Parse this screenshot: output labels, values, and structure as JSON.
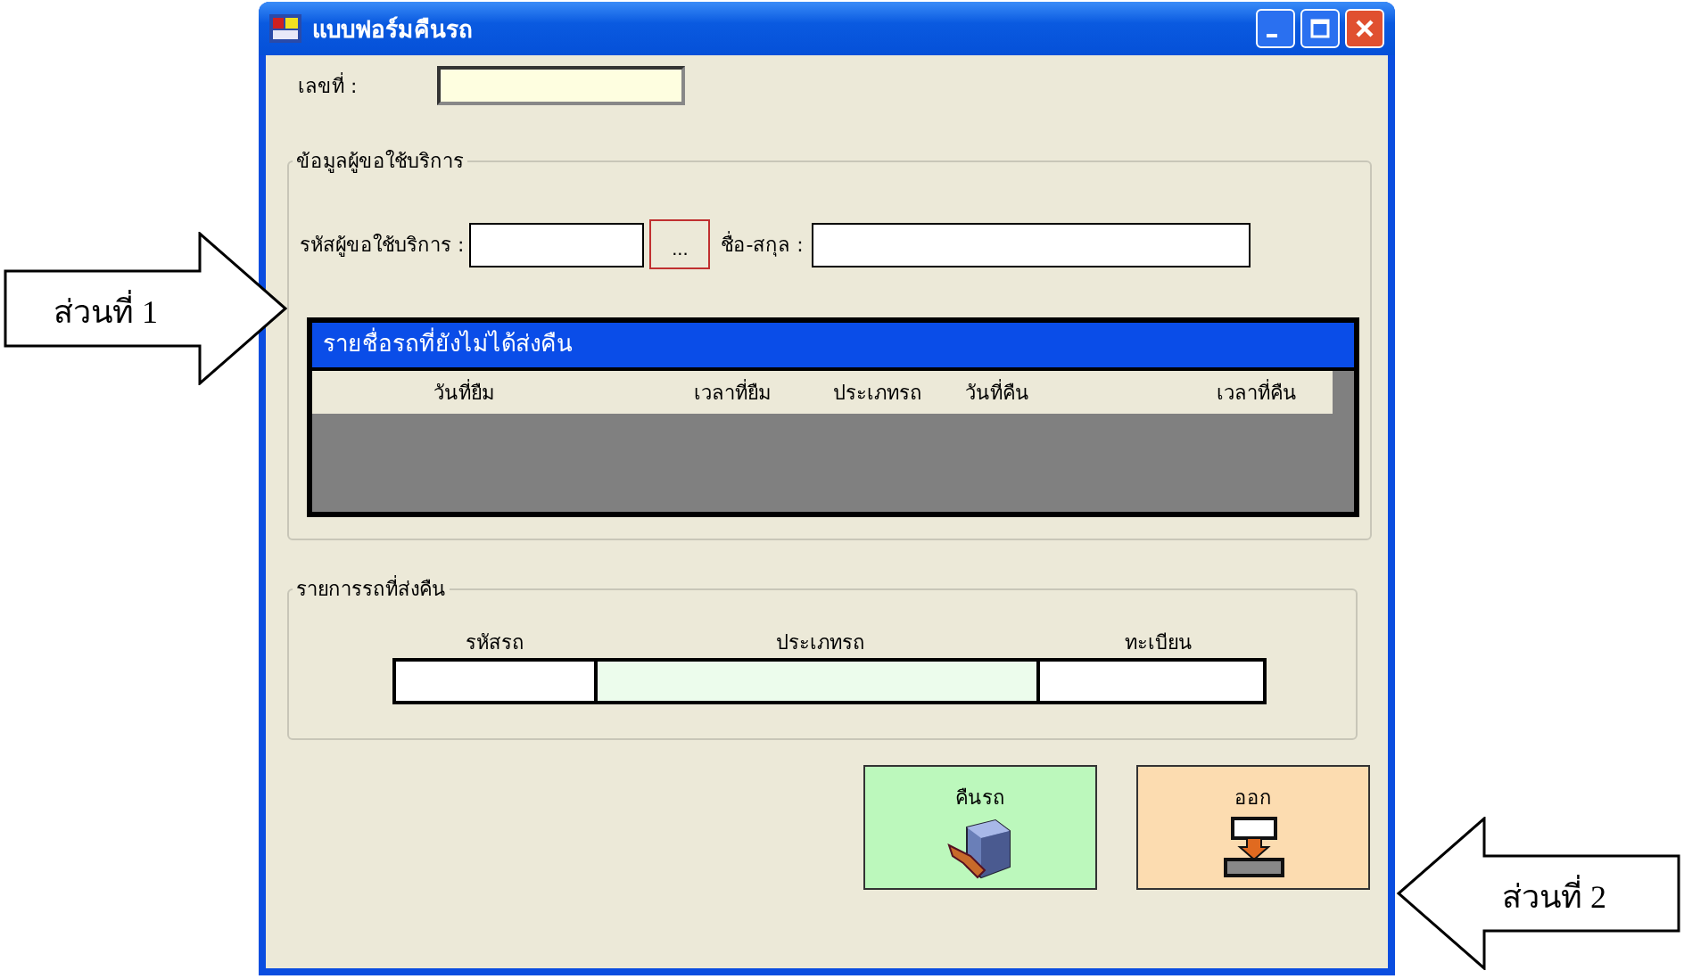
{
  "window": {
    "title": "แบบฟอร์มคืนรถ"
  },
  "number_field": {
    "label": "เลขที่ :"
  },
  "customer_group": {
    "title": "ข้อมูลผู้ขอใช้บริการ",
    "id_label": "รหัสผู้ขอใช้บริการ :",
    "browse_button": "...",
    "name_label": "ชื่อ-สกุล :",
    "pending_list": {
      "title": "รายชื่อรถที่ยังไม่ได้ส่งคืน",
      "columns": [
        "วันที่ยืม",
        "เวลาที่ยืม",
        "ประเภทรถ",
        "วันที่คืน",
        "เวลาที่คืน"
      ]
    }
  },
  "return_group": {
    "title": "รายการรถที่ส่งคืน",
    "columns": [
      "รหัสรถ",
      "ประเภทรถ",
      "ทะเบียน"
    ]
  },
  "buttons": [
    {
      "label": "คืนรถ",
      "kind": "return"
    },
    {
      "label": "ออก",
      "kind": "exit"
    }
  ],
  "callouts": [
    {
      "text": "ส่วนที่ 1",
      "kind": "right"
    },
    {
      "text": "ส่วนที่ 2",
      "kind": "left"
    }
  ]
}
